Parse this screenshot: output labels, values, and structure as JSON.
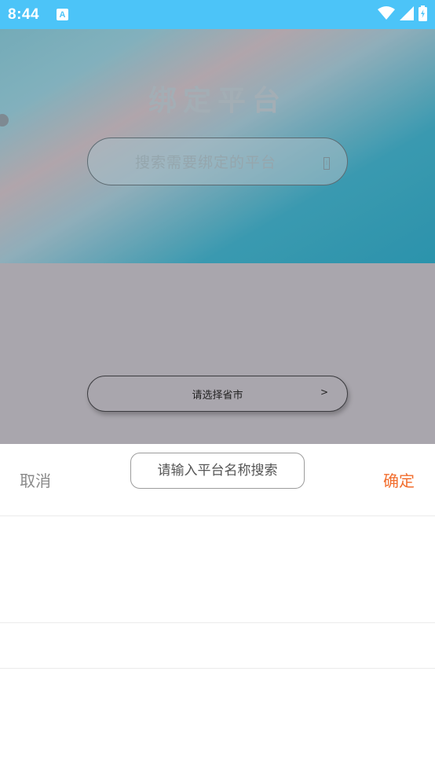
{
  "status_bar": {
    "time": "8:44",
    "notification_icon": "A"
  },
  "page": {
    "title": "绑定平台",
    "platform_search_placeholder": "搜索需要绑定的平台",
    "region_select_label": "请选择省市",
    "region_select_arrow": ">"
  },
  "sheet": {
    "cancel_label": "取消",
    "confirm_label": "确定",
    "search_placeholder": "请输入平台名称搜索"
  },
  "colors": {
    "status_bar": "#4cc4f8",
    "confirm": "#f26e2e",
    "cancel": "#8a8a8a"
  }
}
